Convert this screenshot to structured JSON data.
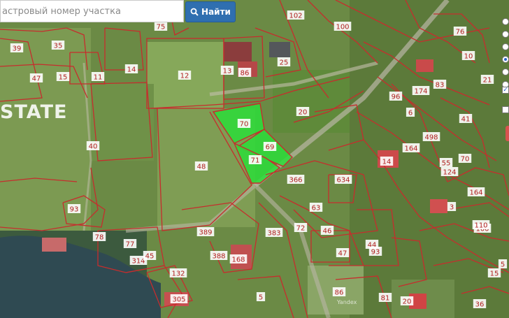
{
  "search": {
    "placeholder": "астровый номер участка",
    "button_label": "Найти"
  },
  "watermark": "STATE",
  "credit": "Yandex",
  "colors": {
    "parcel_border": "#c62d2d",
    "selected_fill": "#2cdd3a",
    "label_bg": "#ffffff",
    "label_text": "#b01e1e",
    "button": "#2f6fb0"
  },
  "layer_panel": {
    "radios": [
      "off",
      "off",
      "off",
      "on",
      "off",
      "off"
    ],
    "checkboxes": [
      "checked",
      "unchecked"
    ]
  },
  "parcel_labels": [
    "39",
    "35",
    "15",
    "47",
    "11",
    "14",
    "12",
    "13",
    "86",
    "25",
    "75",
    "102",
    "100",
    "76",
    "10",
    "20",
    "21",
    "70",
    "69",
    "71",
    "48",
    "40",
    "93",
    "78",
    "77",
    "314",
    "389",
    "383",
    "388",
    "168",
    "132",
    "305",
    "366",
    "634",
    "63",
    "72",
    "46",
    "47",
    "44",
    "86",
    "81",
    "20",
    "36",
    "14",
    "164",
    "55",
    "70",
    "96",
    "174",
    "83",
    "6",
    "41",
    "498",
    "100",
    "124",
    "3",
    "110",
    "164",
    "5",
    "93",
    "5",
    "15",
    "45"
  ]
}
